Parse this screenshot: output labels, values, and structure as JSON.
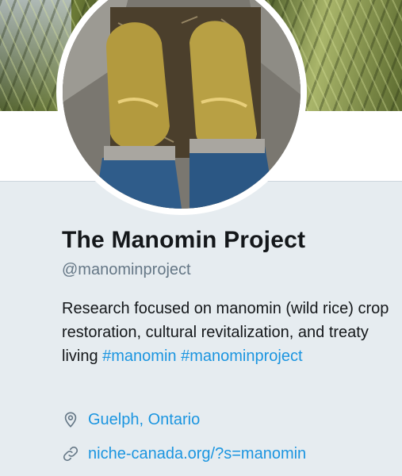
{
  "profile": {
    "name": "The Manomin Project",
    "handle": "@manominproject",
    "bio_text": "Research focused on manomin (wild rice) crop restoration, cultural revitalization, and treaty living",
    "hashtags": [
      "#manomin",
      "#manominproject"
    ],
    "location": "Guelph, Ontario",
    "website": "niche-canada.org/?s=manomin"
  },
  "icons": {
    "location": "location-pin-icon",
    "link": "link-icon"
  },
  "colors": {
    "link": "#1b95e0",
    "page_background": "#e6ecf0",
    "secondary_text": "#657786",
    "primary_text": "#14171a"
  }
}
